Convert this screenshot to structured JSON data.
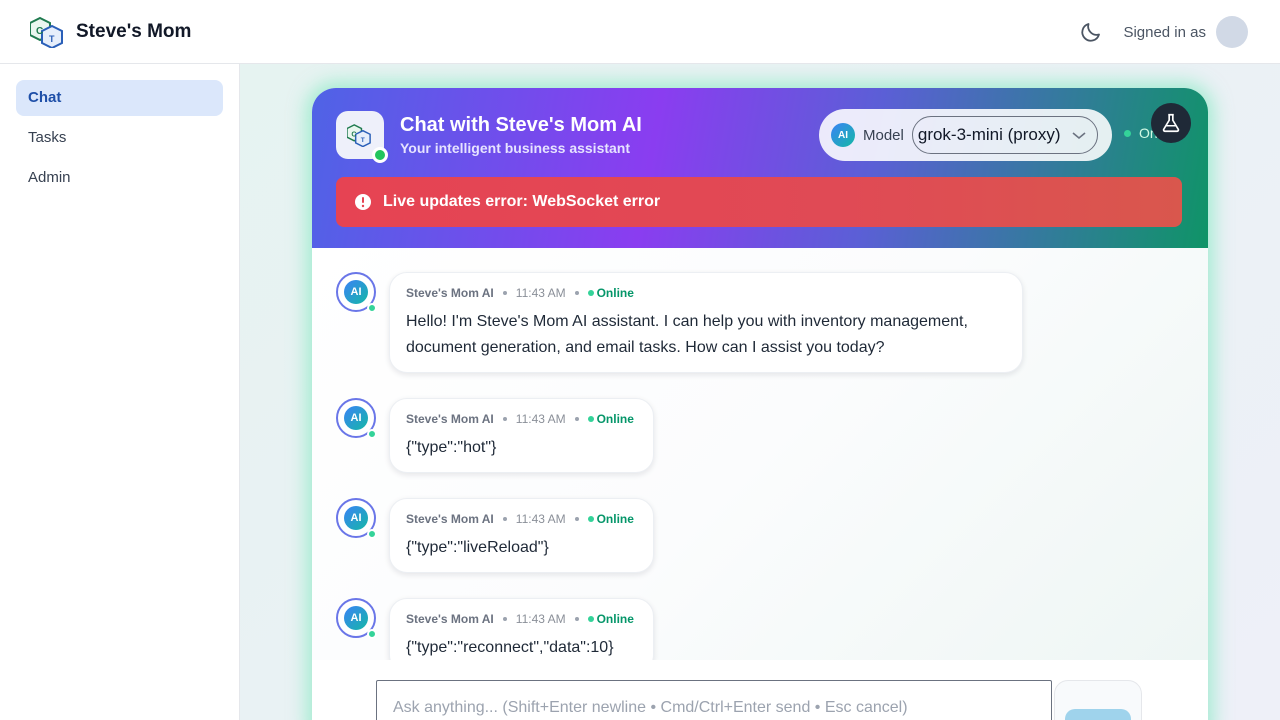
{
  "app": {
    "brand_name": "Steve's Mom",
    "signed_in_label": "Signed in as"
  },
  "sidebar": {
    "items": [
      {
        "label": "Chat",
        "active": true
      },
      {
        "label": "Tasks",
        "active": false
      },
      {
        "label": "Admin",
        "active": false
      }
    ]
  },
  "chat": {
    "title": "Chat with Steve's Mom AI",
    "subtitle": "Your intelligent business assistant",
    "model_badge": "AI",
    "model_label": "Model",
    "model_value": "grok-3-mini (proxy)",
    "status_partial": "On",
    "error_text": "Live updates error: WebSocket error",
    "messages": [
      {
        "avatar": "AI",
        "sender": "Steve's Mom AI",
        "time": "11:43 AM",
        "status": "Online",
        "text": "Hello! I'm Steve's Mom AI assistant. I can help you with inventory management, document generation, and email tasks. How can I assist you today?"
      },
      {
        "avatar": "AI",
        "sender": "Steve's Mom AI",
        "time": "11:43 AM",
        "status": "Online",
        "text": "{\"type\":\"hot\"}"
      },
      {
        "avatar": "AI",
        "sender": "Steve's Mom AI",
        "time": "11:43 AM",
        "status": "Online",
        "text": "{\"type\":\"liveReload\"}"
      },
      {
        "avatar": "AI",
        "sender": "Steve's Mom AI",
        "time": "11:43 AM",
        "status": "Online",
        "text": "{\"type\":\"reconnect\",\"data\":10}"
      }
    ],
    "input_placeholder": "Ask anything... (Shift+Enter newline • Cmd/Ctrl+Enter send • Esc cancel)"
  },
  "colors": {
    "accent_purple": "#8a3df0",
    "accent_green": "#0f9467",
    "error_red": "#e64353",
    "online_green": "#34d399",
    "nav_active_bg": "#dbe7fb"
  },
  "icons": {
    "brand": "ct-cube-logo-icon",
    "theme": "moon-icon",
    "flask": "flask-icon",
    "error": "alert-circle-icon",
    "dropdown": "chevron-down-icon"
  }
}
